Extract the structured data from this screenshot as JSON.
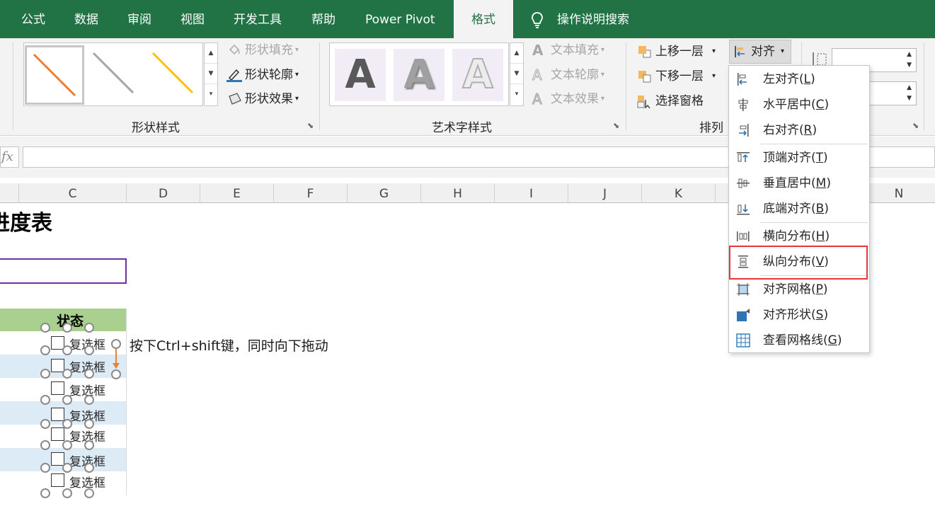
{
  "tabs": [
    {
      "label": "公式",
      "active": false
    },
    {
      "label": "数据",
      "active": false
    },
    {
      "label": "审阅",
      "active": false
    },
    {
      "label": "视图",
      "active": false
    },
    {
      "label": "开发工具",
      "active": false
    },
    {
      "label": "帮助",
      "active": false
    },
    {
      "label": "Power Pivot",
      "active": false
    },
    {
      "label": "格式",
      "active": true
    }
  ],
  "tell_me": {
    "label": "操作说明搜索",
    "icon": "lightbulb-icon"
  },
  "shape_styles": {
    "group_label": "形状样式",
    "fill": "形状填充",
    "outline": "形状轮廓",
    "effects": "形状效果",
    "gallery_colors": [
      "#ED7D31",
      "#A5A5A5",
      "#FFC000"
    ]
  },
  "wordart_styles": {
    "group_label": "艺术字样式",
    "text_fill": "文本填充",
    "text_outline": "文本轮廓",
    "text_effects": "文本效果",
    "tile_letter": "A"
  },
  "arrange": {
    "group_label": "排列",
    "bring_forward": "上移一层",
    "send_backward": "下移一层",
    "selection_pane": "选择窗格",
    "align": "对齐"
  },
  "align_menu": {
    "items": [
      {
        "label": "左对齐",
        "key": "L",
        "icon": "align-left-icon"
      },
      {
        "label": "水平居中",
        "key": "C",
        "icon": "align-center-icon"
      },
      {
        "label": "右对齐",
        "key": "R",
        "icon": "align-right-icon"
      },
      {
        "label": "顶端对齐",
        "key": "T",
        "icon": "align-top-icon"
      },
      {
        "label": "垂直居中",
        "key": "M",
        "icon": "align-middle-icon"
      },
      {
        "label": "底端对齐",
        "key": "B",
        "icon": "align-bottom-icon"
      },
      {
        "label": "横向分布",
        "key": "H",
        "icon": "distribute-horizontal-icon"
      },
      {
        "label": "纵向分布",
        "key": "V",
        "icon": "distribute-vertical-icon",
        "highlighted": true
      },
      {
        "label": "对齐网格",
        "key": "P",
        "icon": "snap-grid-icon"
      },
      {
        "label": "对齐形状",
        "key": "S",
        "icon": "snap-shape-icon"
      },
      {
        "label": "查看网格线",
        "key": "G",
        "icon": "view-gridlines-icon"
      }
    ]
  },
  "formula_bar": {
    "fx": "fx",
    "value": ""
  },
  "columns": [
    "C",
    "D",
    "E",
    "F",
    "G",
    "H",
    "I",
    "J",
    "K",
    "N"
  ],
  "sheet": {
    "title": "进度表",
    "status_header": "状态",
    "checkbox_label": "复选框",
    "checkbox_count": 7,
    "instruction": "按下Ctrl+shift键，同时向下拖动",
    "accent_purple": "#7030A0",
    "header_green": "#A9D08E",
    "band_blue": "#DDEBF7"
  }
}
